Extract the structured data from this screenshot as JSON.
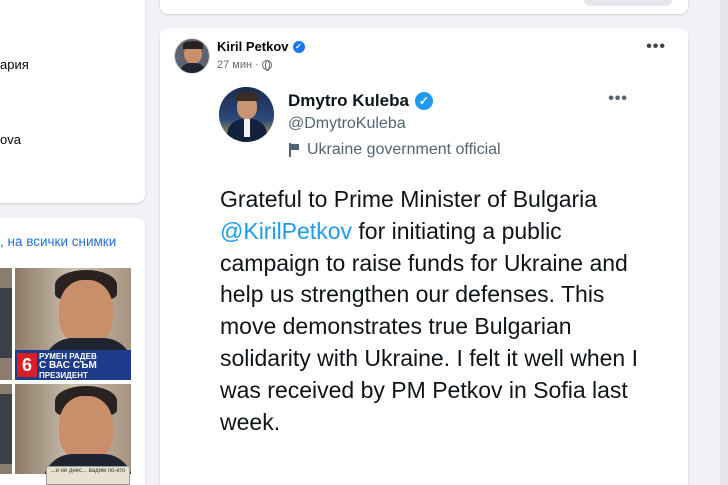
{
  "left_sidebar": {
    "fragment_1": "ария",
    "fragment_2": "ova",
    "photos_link": ", на всички снимки",
    "photo_1": {
      "badge_number": "6",
      "badge_line_1": "РУМЕН РАДЕВ",
      "badge_line_2": "С ВАС СЪМ",
      "badge_line_3": "ПРЕЗИДЕНТ"
    },
    "bottom_logo_text": "...и не днес... вадим по-ето"
  },
  "post": {
    "author": "Kiril Petkov",
    "time": "27 мин",
    "separator": "·",
    "more_icon": "•••"
  },
  "tweet": {
    "name": "Dmytro Kuleba",
    "handle": "@DmytroKuleba",
    "label": "Ukraine government official",
    "more_icon": "•••",
    "text_before": "Grateful to Prime Minister of Bulgaria ",
    "mention": "@KirilPetkov",
    "text_after": " for initiating a public campaign to raise funds for Ukraine and help us strengthen our defenses. This move demonstrates true Bulgarian solidarity with Ukraine. I felt it well when I was received by PM Petkov in Sofia last week."
  },
  "colors": {
    "facebook_blue": "#1877f2",
    "twitter_blue": "#1d9bf0",
    "link_blue": "#216fdb",
    "background": "#f0f2f5"
  }
}
